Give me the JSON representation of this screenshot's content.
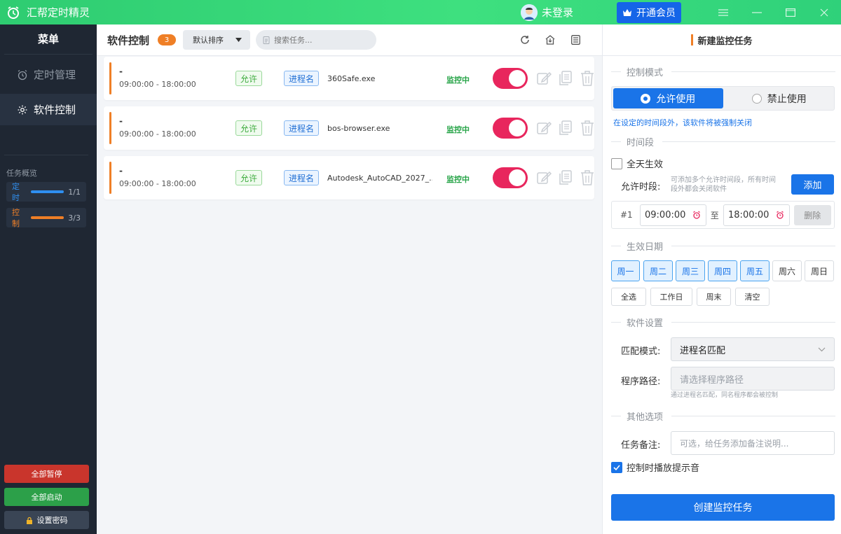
{
  "app": {
    "title": "汇帮定时精灵"
  },
  "titlebar": {
    "user": "未登录",
    "vip_button": "开通会员"
  },
  "sidebar": {
    "menu_title": "菜单",
    "items": [
      {
        "label": "定时管理"
      },
      {
        "label": "软件控制"
      }
    ],
    "overview_label": "任务概览",
    "overview": [
      {
        "label": "定时",
        "count": "1/1",
        "color": "#2f8ff0"
      },
      {
        "label": "控制",
        "count": "3/3",
        "color": "#ef7f26"
      }
    ],
    "pause_all": "全部暂停",
    "start_all": "全部启动",
    "set_password": "设置密码"
  },
  "center": {
    "title": "软件控制",
    "count": "3",
    "sort": "默认排序",
    "search_placeholder": "搜索任务...",
    "tasks": [
      {
        "name": "-",
        "time": "09:00:00 - 18:00:00",
        "mode": "允许",
        "match": "进程名",
        "exe": "360Safe.exe",
        "status": "监控中",
        "enabled": true
      },
      {
        "name": "-",
        "time": "09:00:00 - 18:00:00",
        "mode": "允许",
        "match": "进程名",
        "exe": "bos-browser.exe",
        "status": "监控中",
        "enabled": true
      },
      {
        "name": "-",
        "time": "09:00:00 - 18:00:00",
        "mode": "允许",
        "match": "进程名",
        "exe": "Autodesk_AutoCAD_2027_...",
        "status": "监控中",
        "enabled": true
      }
    ]
  },
  "form": {
    "title": "新建监控任务",
    "control_mode_label": "控制模式",
    "allow": "允许使用",
    "deny": "禁止使用",
    "mode_hint": "在设定的时间段外，该软件将被强制关闭",
    "period_label": "时间段",
    "all_day": "全天生效",
    "allowed_period": "允许时段:",
    "period_hint_1": "可添加多个允许时间段，所有时间",
    "period_hint_2": "段外都会关闭软件",
    "add": "添加",
    "slot_index": "#1",
    "start_time": "09:00:00",
    "to": "至",
    "end_time": "18:00:00",
    "delete": "删除",
    "date_label": "生效日期",
    "days": [
      {
        "label": "周一",
        "on": true
      },
      {
        "label": "周二",
        "on": true
      },
      {
        "label": "周三",
        "on": true
      },
      {
        "label": "周四",
        "on": true
      },
      {
        "label": "周五",
        "on": true
      },
      {
        "label": "周六",
        "on": false
      },
      {
        "label": "周日",
        "on": false
      }
    ],
    "select_all": "全选",
    "workdays": "工作日",
    "weekend": "周末",
    "clear": "清空",
    "software_settings": "软件设置",
    "match_mode_label": "匹配模式:",
    "match_mode_value": "进程名匹配",
    "path_label": "程序路径:",
    "path_placeholder": "请选择程序路径",
    "path_hint": "通过进程名匹配，同名程序都会被控制",
    "other_label": "其他选项",
    "note_label": "任务备注:",
    "note_placeholder": "可选，给任务添加备注说明...",
    "sound": "控制时播放提示音",
    "create": "创建监控任务"
  }
}
